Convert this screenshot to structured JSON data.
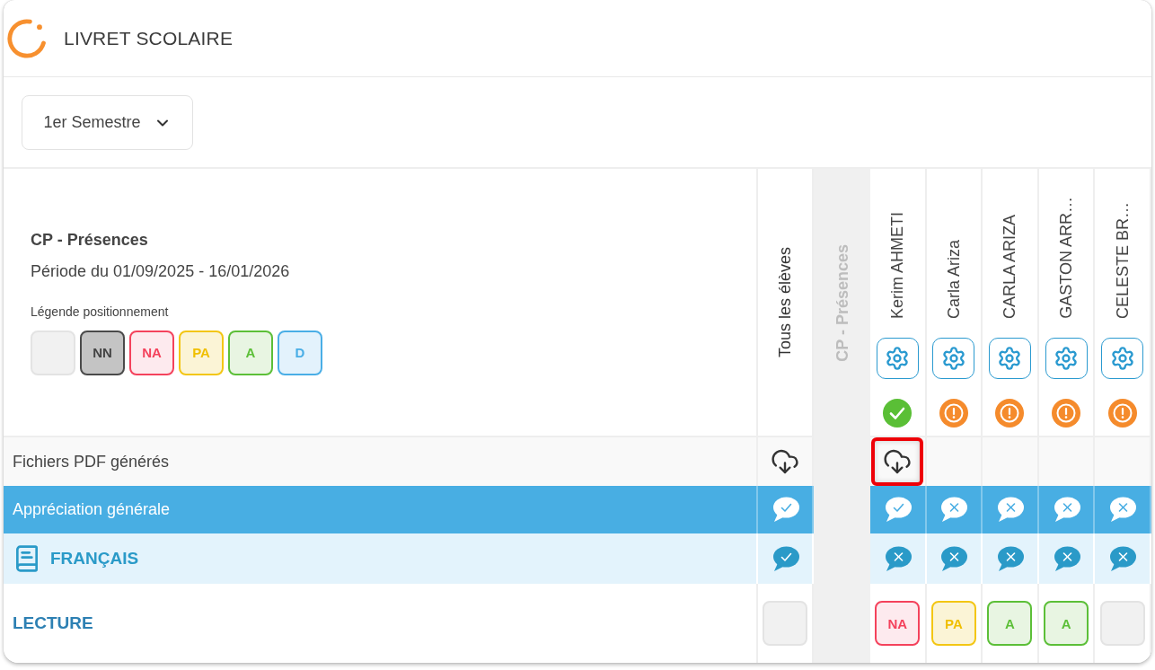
{
  "header": {
    "title": "LIVRET SCOLAIRE"
  },
  "period_select": {
    "value": "1er Semestre"
  },
  "summary": {
    "title": "CP - Présences",
    "period": "Période du 01/09/2025 - 16/01/2026",
    "legend_title": "Légende positionnement",
    "legend": [
      {
        "kind": "none"
      },
      {
        "kind": "nn",
        "label": "NN"
      },
      {
        "kind": "na",
        "label": "NA"
      },
      {
        "kind": "pa",
        "label": "PA"
      },
      {
        "kind": "a",
        "label": "A"
      },
      {
        "kind": "d",
        "label": "D"
      }
    ]
  },
  "all_students_column": {
    "title": "Tous les élèves"
  },
  "group_column": {
    "title": "CP - Présences"
  },
  "students": [
    {
      "name": "Kerim AHMETI",
      "complete": true
    },
    {
      "name": "Carla Ariza",
      "complete": false
    },
    {
      "name": "CARLA ARIZA",
      "complete": false
    },
    {
      "name": "GASTON ARR…",
      "complete": false
    },
    {
      "name": "CELESTE BR…",
      "complete": false
    }
  ],
  "rows": [
    {
      "kind": "files",
      "label": "Fichiers PDF générés",
      "all": {
        "available": true,
        "highlighted": false
      },
      "cells": [
        {
          "available": true,
          "highlighted": true
        },
        {
          "available": false,
          "highlighted": false
        },
        {
          "available": false,
          "highlighted": false
        },
        {
          "available": false,
          "highlighted": false
        },
        {
          "available": false,
          "highlighted": false
        }
      ]
    },
    {
      "kind": "appreciation",
      "label": "Appréciation générale",
      "all": {
        "validated": true
      },
      "cells": [
        {
          "validated": true
        },
        {
          "validated": false
        },
        {
          "validated": false
        },
        {
          "validated": false
        },
        {
          "validated": false
        }
      ]
    },
    {
      "kind": "subject",
      "label": "FRANÇAIS",
      "all": {
        "validated": true
      },
      "cells": [
        {
          "validated": false
        },
        {
          "validated": false
        },
        {
          "validated": false
        },
        {
          "validated": false
        },
        {
          "validated": false
        }
      ]
    },
    {
      "kind": "skill",
      "label": "LECTURE",
      "all": {
        "kind": "none"
      },
      "cells": [
        {
          "kind": "na",
          "label": "NA"
        },
        {
          "kind": "pa",
          "label": "PA"
        },
        {
          "kind": "a",
          "label": "A"
        },
        {
          "kind": "a",
          "label": "A"
        },
        {
          "kind": "none"
        }
      ]
    }
  ]
}
